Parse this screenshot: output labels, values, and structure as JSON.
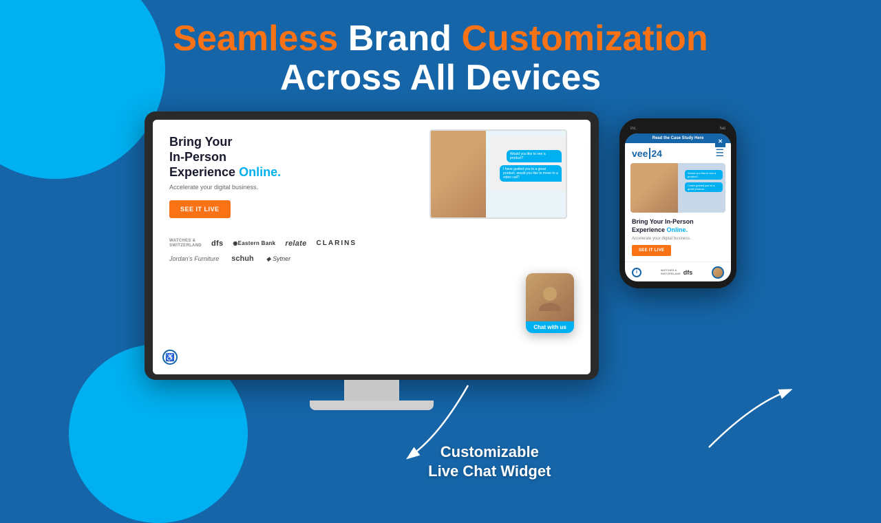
{
  "header": {
    "line1_orange": "Seamless",
    "line1_white": " Brand ",
    "line1_orange2": "Customization",
    "line2": "Across All Devices"
  },
  "desktop_screen": {
    "headline_line1": "Bring Your",
    "headline_line2": "In-Person",
    "headline_line3": "Experience",
    "headline_online": "Online.",
    "tagline": "Accelerate your digital business.",
    "cta_label": "SEE IT LIVE",
    "logos_row1": [
      "WATCHES & SWITZERLAND",
      "dfs",
      "◉Eastern Bank",
      "relate",
      "CLARINS"
    ],
    "logos_row2": [
      "Jordan's Furniture",
      "schuh",
      "◆ Sytner"
    ],
    "chat_widget_label": "Chat with us"
  },
  "phone_screen": {
    "top_banner": "Read the Case Study Here",
    "logo": "vee 24",
    "headline_line1": "Bring Your In-Person",
    "headline_line2": "Experience",
    "headline_online": "Online.",
    "tagline": "Accelerate your digital business.",
    "cta_label": "SEE IT LIVE",
    "bottom_logos": [
      "WATCHES & SWITZERLAND",
      "dfs"
    ]
  },
  "caption": {
    "line1": "Customizable",
    "line2": "Live Chat Widget"
  },
  "accessibility_label": "♿",
  "info_label": "i"
}
